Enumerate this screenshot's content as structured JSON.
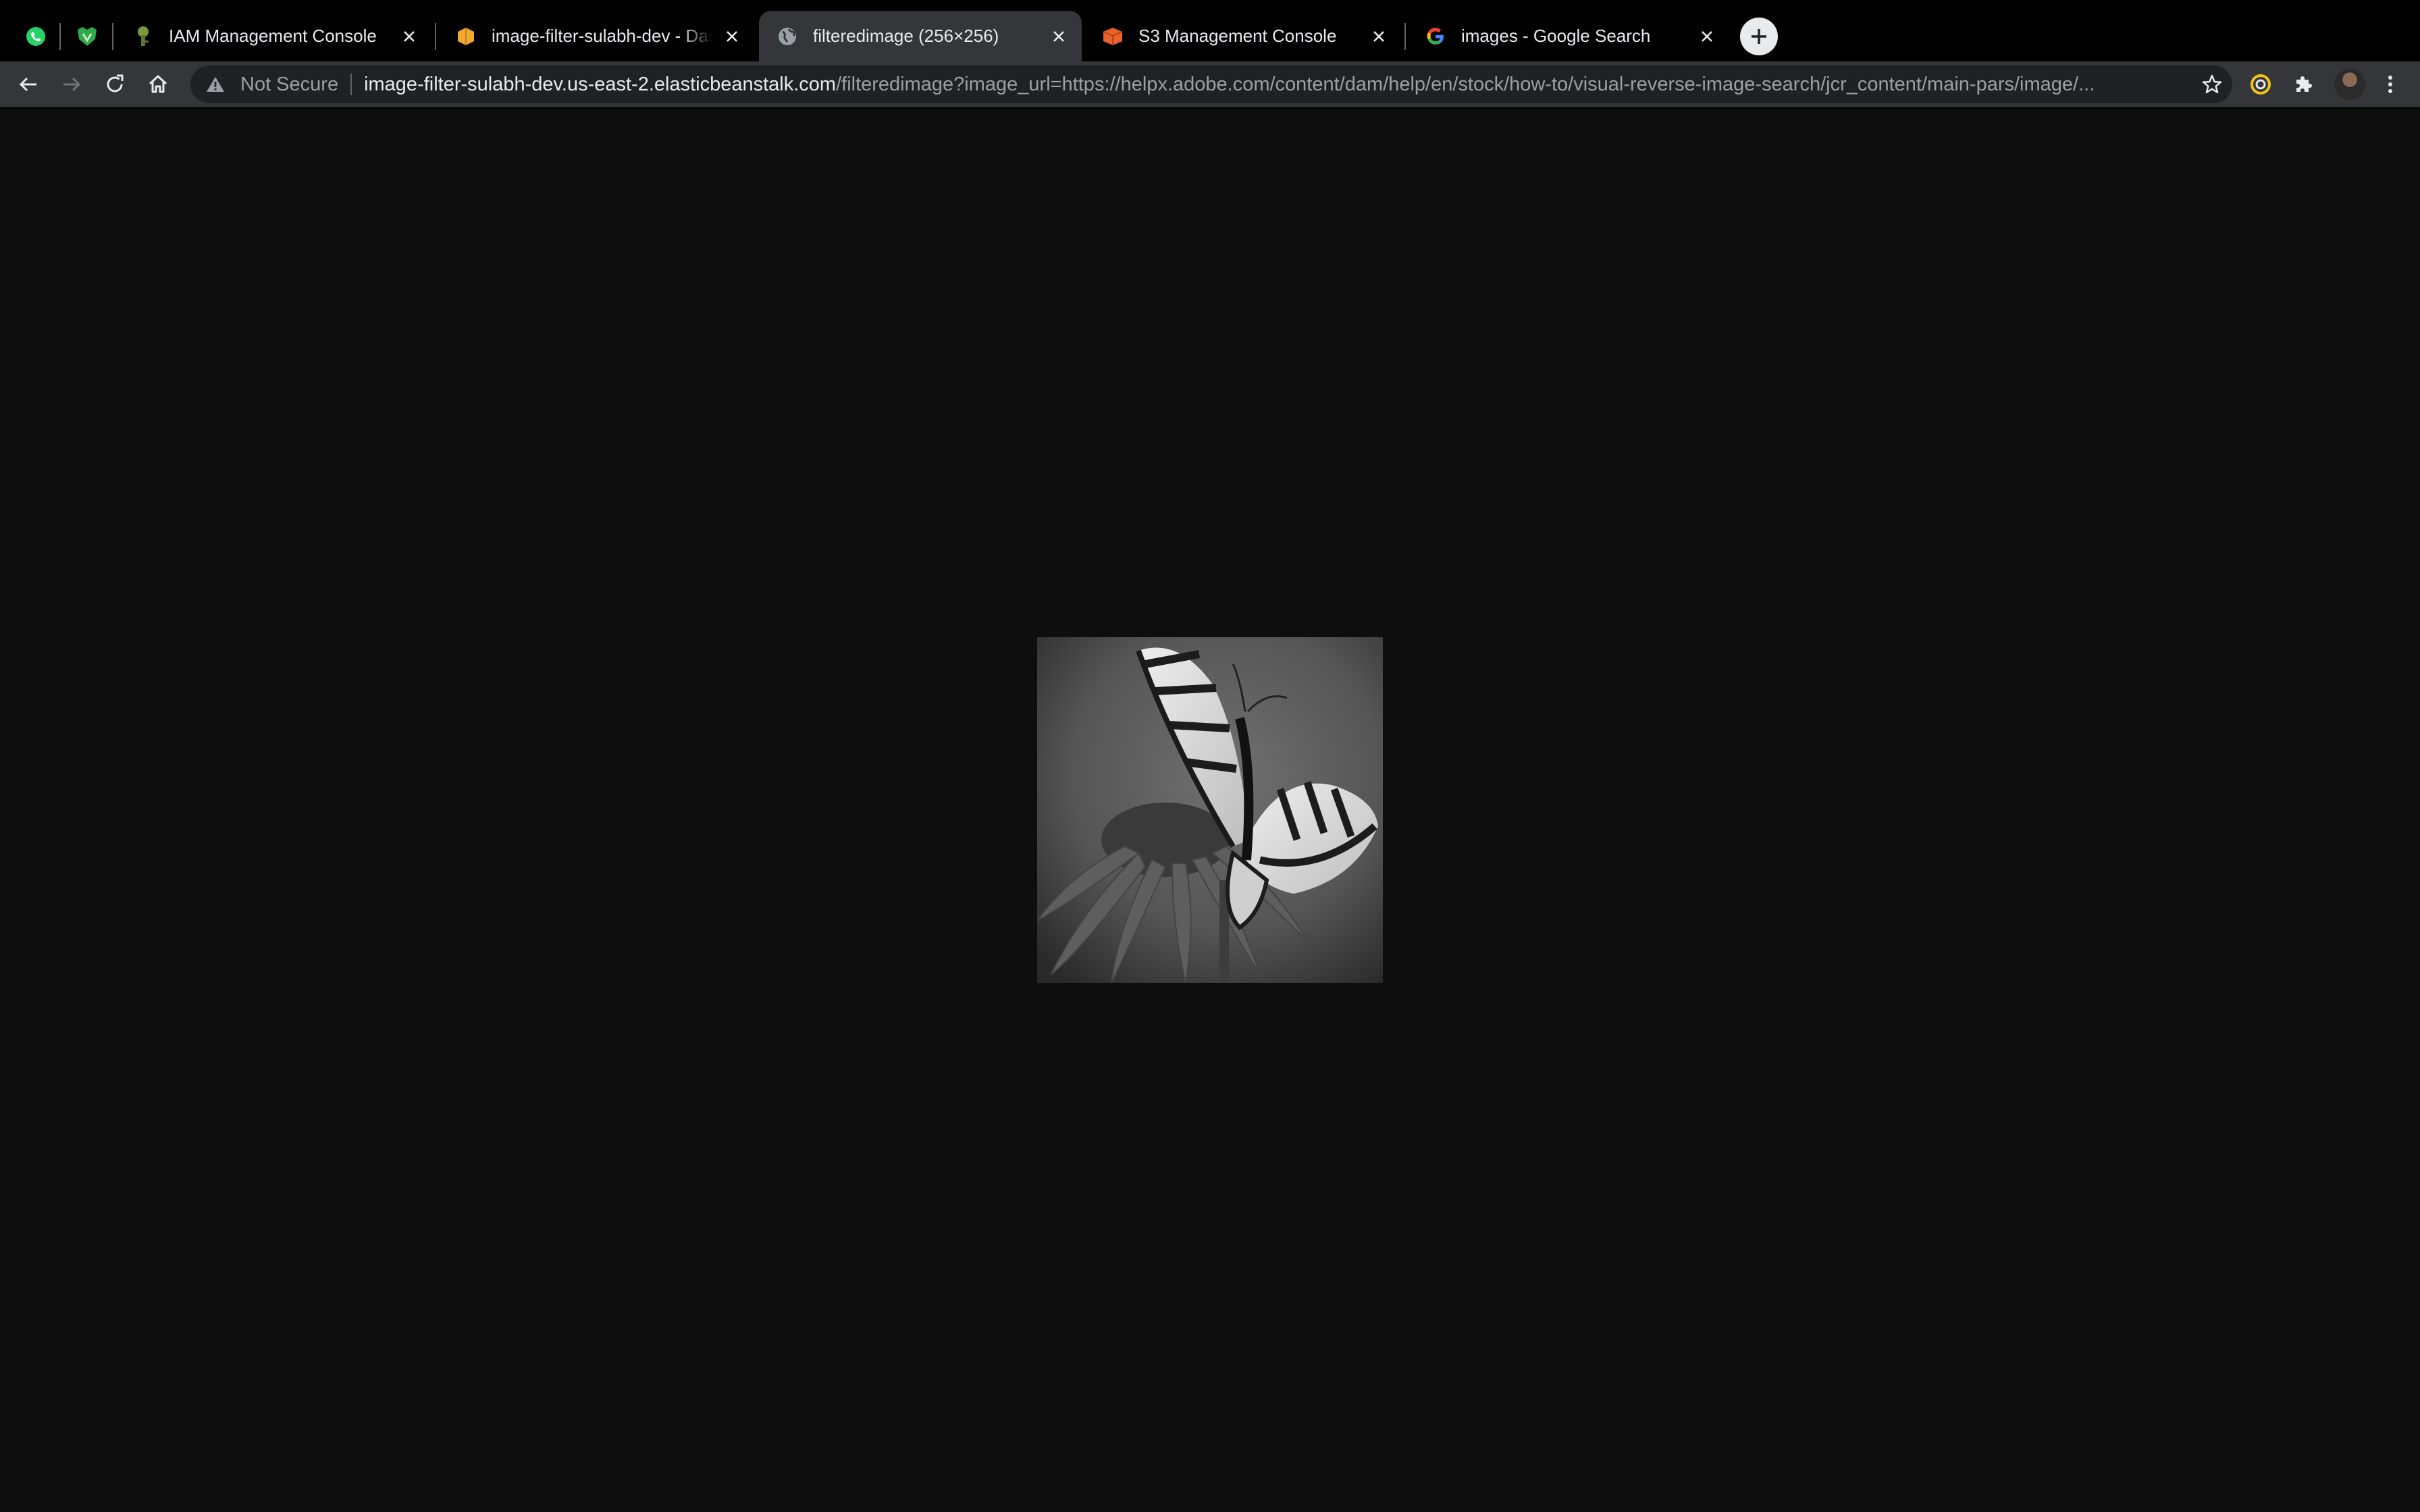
{
  "tabs": [
    {
      "title": "IAM Management Console",
      "icon": "iam-icon"
    },
    {
      "title": "image-filter-sulabh-dev - Dash",
      "icon": "beanstalk-icon"
    },
    {
      "title": "filteredimage (256×256)",
      "icon": "globe-icon",
      "active": true
    },
    {
      "title": "S3 Management Console",
      "icon": "s3-icon"
    },
    {
      "title": "images - Google Search",
      "icon": "google-icon"
    }
  ],
  "pinned_tabs": [
    {
      "icon": "whatsapp-icon"
    },
    {
      "icon": "tunnelbear-icon"
    }
  ],
  "omnibox": {
    "security_label": "Not Secure",
    "url_host": "image-filter-sulabh-dev.us-east-2.elasticbeanstalk.com",
    "url_path": "/filteredimage?image_url=https://helpx.adobe.com/content/dam/help/en/stock/how-to/visual-reverse-image-search/jcr_content/main-pars/image/..."
  },
  "content": {
    "image_subject": "grayscale swallowtail butterfly on coneflower",
    "background_color": "#0e0e0e"
  },
  "colors": {
    "tabstrip": "#000000",
    "toolbar": "#35363a",
    "omnibox": "#202124",
    "text": "#e8eaed",
    "muted": "#9aa0a6"
  }
}
